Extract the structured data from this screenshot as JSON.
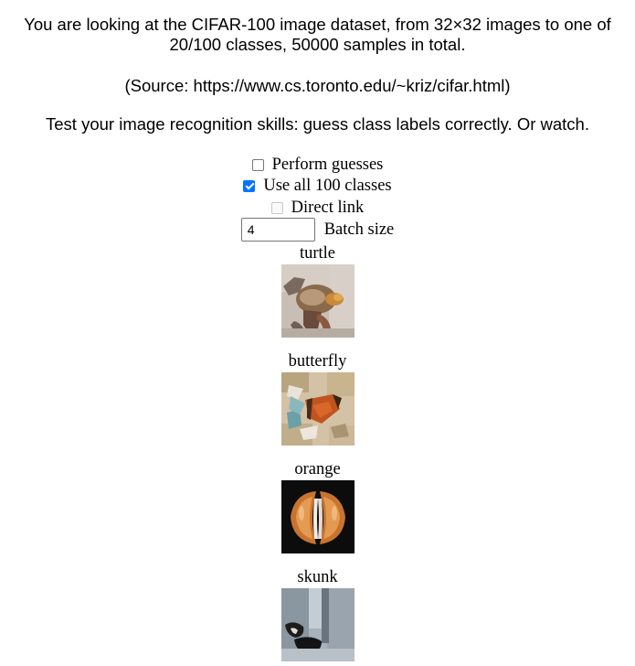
{
  "intro": {
    "line1": "You are looking at the CIFAR-100 image dataset, from 32×32 images to one of 20/100 classes, 50000 samples in total.",
    "source": "(Source: https://www.cs.toronto.edu/~kriz/cifar.html)",
    "prompt": "Test your image recognition skills: guess class labels correctly. Or watch."
  },
  "controls": {
    "perform_guesses": {
      "label": "Perform guesses",
      "checked": false
    },
    "use_all_classes": {
      "label": "Use all 100 classes",
      "checked": true
    },
    "direct_link": {
      "label": "Direct link",
      "checked": false,
      "disabled": true
    },
    "batch_size": {
      "label": "Batch size",
      "value": "4"
    }
  },
  "samples": [
    {
      "label": "turtle"
    },
    {
      "label": "butterfly"
    },
    {
      "label": "orange"
    },
    {
      "label": "skunk"
    }
  ]
}
